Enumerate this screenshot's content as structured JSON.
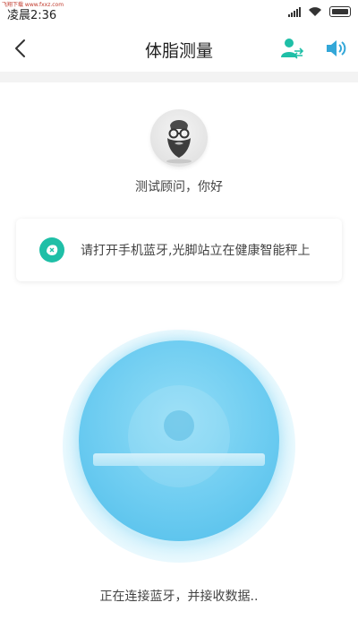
{
  "status_bar": {
    "time": "凌晨2:36",
    "watermark": "飞翔下载 www.fxxz.com"
  },
  "header": {
    "title": "体脂测量",
    "icons": [
      "back-arrow-icon",
      "user-switch-icon",
      "speaker-icon"
    ]
  },
  "profile": {
    "greeting": "测试顾问，你好"
  },
  "tip": {
    "text": "请打开手机蓝牙,光脚站立在健康智能秤上",
    "icon": "bluetooth-scale-icon"
  },
  "connection": {
    "status": "正在连接蓝牙，并接收数据.."
  },
  "colors": {
    "accent": "#1fbfa7",
    "circle": "#6dccf1"
  }
}
